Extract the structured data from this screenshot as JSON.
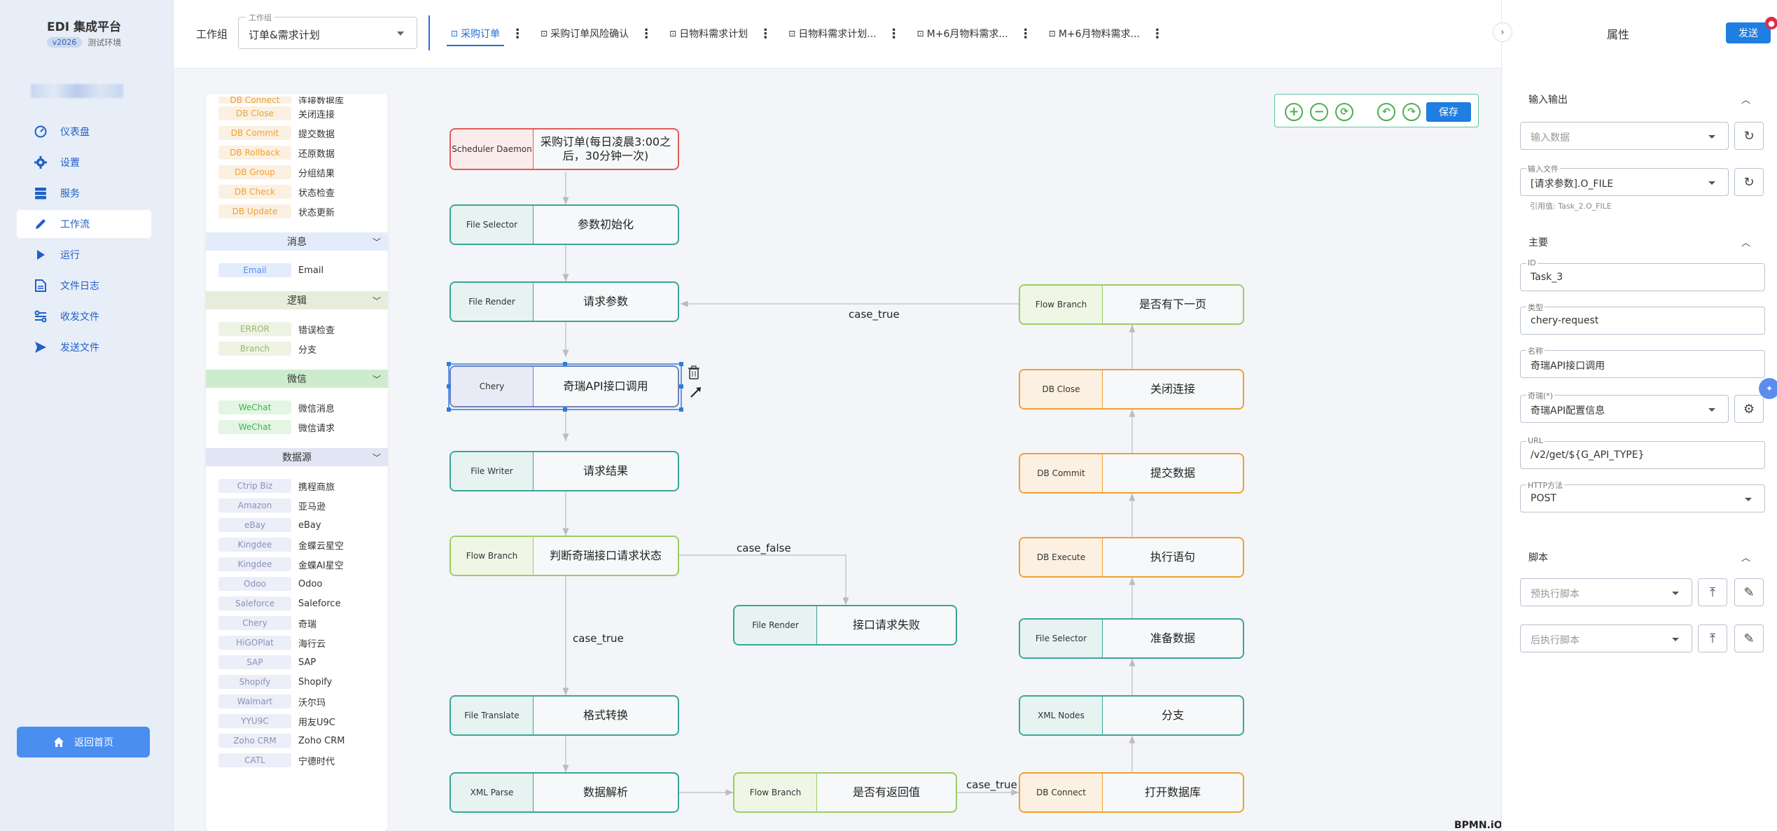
{
  "brand": {
    "title": "EDI 集成平台",
    "version": "v2026",
    "env": "测试环境"
  },
  "nav": [
    {
      "label": "仪表盘",
      "icon": "dashboard-icon"
    },
    {
      "label": "设置",
      "icon": "gear-icon"
    },
    {
      "label": "服务",
      "icon": "server-icon"
    },
    {
      "label": "工作流",
      "icon": "pencil-icon",
      "active": true
    },
    {
      "label": "运行",
      "icon": "play-icon"
    },
    {
      "label": "文件日志",
      "icon": "file-icon"
    },
    {
      "label": "收发文件",
      "icon": "transfer-icon"
    },
    {
      "label": "发送文件",
      "icon": "send-icon"
    }
  ],
  "home_button": "返回首页",
  "header": {
    "workgroup_label": "工作组",
    "workgroup_float": "工作组",
    "workgroup_value": "订单&需求计划",
    "tabs": [
      {
        "label": "采购订单",
        "active": true
      },
      {
        "label": "采购订单风险确认"
      },
      {
        "label": "日物料需求计划"
      },
      {
        "label": "日物料需求计划..."
      },
      {
        "label": "M+6月物料需求..."
      },
      {
        "label": "M+6月物料需求..."
      }
    ]
  },
  "palette": {
    "top_items": [
      {
        "tag": "DB Connect",
        "label": "连接数据库"
      },
      {
        "tag": "DB Close",
        "label": "关闭连接"
      },
      {
        "tag": "DB Commit",
        "label": "提交数据"
      },
      {
        "tag": "DB Rollback",
        "label": "还原数据"
      },
      {
        "tag": "DB Group",
        "label": "分组结果"
      },
      {
        "tag": "DB Check",
        "label": "状态检查"
      },
      {
        "tag": "DB Update",
        "label": "状态更新"
      }
    ],
    "sections": [
      {
        "title": "消息",
        "tag_color": "#5b8def",
        "tag_bg": "#e3ecfb",
        "hdr_bg": "#e3ecfb",
        "items": [
          {
            "tag": "Email",
            "label": "Email"
          }
        ]
      },
      {
        "title": "逻辑",
        "tag_color": "#9bb86a",
        "tag_bg": "#eef3e4",
        "hdr_bg": "#e6eedb",
        "items": [
          {
            "tag": "ERROR",
            "label": "错误检查"
          },
          {
            "tag": "Branch",
            "label": "分支"
          }
        ]
      },
      {
        "title": "微信",
        "tag_color": "#3bb54a",
        "tag_bg": "#e4f5e4",
        "hdr_bg": "#cdeccd",
        "items": [
          {
            "tag": "WeChat",
            "label": "微信消息"
          },
          {
            "tag": "WeChat",
            "label": "微信请求"
          }
        ]
      },
      {
        "title": "数据源",
        "tag_color": "#8a90b8",
        "tag_bg": "#eceef8",
        "hdr_bg": "#e2e5f3",
        "items": [
          {
            "tag": "Ctrip Biz",
            "label": "携程商旅"
          },
          {
            "tag": "Amazon",
            "label": "亚马逊"
          },
          {
            "tag": "eBay",
            "label": "eBay"
          },
          {
            "tag": "Kingdee",
            "label": "金蝶云星空"
          },
          {
            "tag": "Kingdee",
            "label": "金蝶AI星空"
          },
          {
            "tag": "Odoo",
            "label": "Odoo"
          },
          {
            "tag": "Saleforce",
            "label": "Saleforce"
          },
          {
            "tag": "Chery",
            "label": "奇瑞"
          },
          {
            "tag": "HiGOPlat",
            "label": "海行云"
          },
          {
            "tag": "SAP",
            "label": "SAP"
          },
          {
            "tag": "Shopify",
            "label": "Shopify"
          },
          {
            "tag": "Walmart",
            "label": "沃尔玛"
          },
          {
            "tag": "YYU9C",
            "label": "用友U9C"
          },
          {
            "tag": "Zoho CRM",
            "label": "Zoho CRM"
          },
          {
            "tag": "CATL",
            "label": "宁德时代"
          }
        ]
      }
    ]
  },
  "toolbar": {
    "save": "保存",
    "icons": [
      "zoom-in-icon",
      "zoom-out-icon",
      "reset-icon",
      "undo-icon",
      "redo-icon"
    ]
  },
  "nodes": [
    {
      "id": "n1",
      "type": "Scheduler Daemon",
      "name": "采购订单(每日凌晨3:00之后，30分钟一次)",
      "color": "#e05a5a",
      "bg": "#fbecec"
    },
    {
      "id": "n2",
      "type": "File Selector",
      "name": "参数初始化",
      "color": "#3aa597",
      "bg": "#e6f3f1"
    },
    {
      "id": "n3",
      "type": "File Render",
      "name": "请求参数",
      "color": "#3aa597",
      "bg": "#e6f3f1"
    },
    {
      "id": "n4",
      "type": "Chery",
      "name": "奇瑞API接口调用",
      "color": "#7280b8",
      "bg": "#e8eaf5"
    },
    {
      "id": "n5",
      "type": "File Writer",
      "name": "请求结果",
      "color": "#3aa597",
      "bg": "#e6f3f1"
    },
    {
      "id": "n6",
      "type": "Flow Branch",
      "name": "判断奇瑞接口请求状态",
      "color": "#9ccc65",
      "bg": "#eff6e6"
    },
    {
      "id": "n7",
      "type": "File Render",
      "name": "接口请求失败",
      "color": "#3aa597",
      "bg": "#e6f3f1"
    },
    {
      "id": "n8",
      "type": "File Translate",
      "name": "格式转换",
      "color": "#3aa597",
      "bg": "#e6f3f1"
    },
    {
      "id": "n9",
      "type": "XML Parse",
      "name": "数据解析",
      "color": "#3aa597",
      "bg": "#e6f3f1"
    },
    {
      "id": "n10",
      "type": "Flow Branch",
      "name": "是否有返回值",
      "color": "#9ccc65",
      "bg": "#eff6e6"
    },
    {
      "id": "n11",
      "type": "DB Connect",
      "name": "打开数据库",
      "color": "#f0a030",
      "bg": "#fbf0e2"
    },
    {
      "id": "n12",
      "type": "XML Nodes",
      "name": "分支",
      "color": "#3aa597",
      "bg": "#e6f3f1"
    },
    {
      "id": "n13",
      "type": "File Selector",
      "name": "准备数据",
      "color": "#3aa597",
      "bg": "#e6f3f1"
    },
    {
      "id": "n14",
      "type": "DB Execute",
      "name": "执行语句",
      "color": "#f0a030",
      "bg": "#fbf0e2"
    },
    {
      "id": "n15",
      "type": "DB Commit",
      "name": "提交数据",
      "color": "#f0a030",
      "bg": "#fbf0e2"
    },
    {
      "id": "n16",
      "type": "DB Close",
      "name": "关闭连接",
      "color": "#f0a030",
      "bg": "#fbf0e2"
    },
    {
      "id": "n17",
      "type": "Flow Branch",
      "name": "是否有下一页",
      "color": "#9ccc65",
      "bg": "#eff6e6"
    }
  ],
  "edge_labels": {
    "e_next": "case_true",
    "e_false": "case_false",
    "e_true": "case_true",
    "e_ret": "case_true"
  },
  "watermark": "BPMN.iO",
  "panel": {
    "title": "属性",
    "send": "发送",
    "send_badge": "●",
    "sections": {
      "io": "输入输出",
      "main": "主要",
      "script": "脚本"
    },
    "input_data_placeholder": "输入数据",
    "input_file_label": "输入文件",
    "input_file_value": "[请求参数].O_FILE",
    "input_file_hint": "引用值: Task_2.O_FILE",
    "id_label": "ID",
    "id_value": "Task_3",
    "type_label": "类型",
    "type_value": "chery-request",
    "name_label": "名称",
    "name_value": "奇瑞API接口调用",
    "chery_label": "奇瑞(*)",
    "chery_value": "奇瑞API配置信息",
    "url_label": "URL",
    "url_value": "/v2/get/${G_API_TYPE}",
    "http_label": "HTTP方法",
    "http_value": "POST",
    "pre_script": "预执行脚本",
    "post_script": "后执行脚本"
  }
}
